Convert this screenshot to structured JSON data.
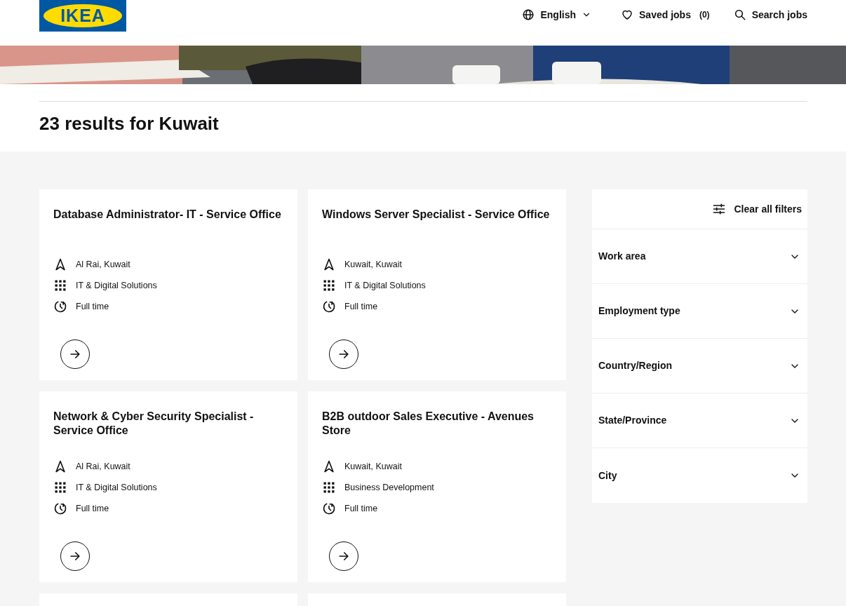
{
  "header": {
    "logo": "IKEA",
    "language": "English",
    "saved_jobs": {
      "label": "Saved jobs",
      "count": "(0)"
    },
    "search": "Search jobs"
  },
  "results_heading": "23 results for Kuwait",
  "jobs": [
    {
      "title": "Database Administrator- IT - Service Office",
      "location": "Al Rai, Kuwait",
      "work_area": "IT & Digital Solutions",
      "schedule": "Full time"
    },
    {
      "title": "Windows Server Specialist - Service Office",
      "location": "Kuwait, Kuwait",
      "work_area": "IT & Digital Solutions",
      "schedule": "Full time"
    },
    {
      "title": "Network & Cyber Security Specialist - Service Office",
      "location": "Al Rai, Kuwait",
      "work_area": "IT & Digital Solutions",
      "schedule": "Full time"
    },
    {
      "title": "B2B outdoor Sales Executive - Avenues Store",
      "location": "Kuwait, Kuwait",
      "work_area": "Business Development",
      "schedule": "Full time"
    }
  ],
  "filters": {
    "clear_label": "Clear all filters",
    "items": [
      {
        "label": "Work area",
        "expanded": false
      },
      {
        "label": "Employment type",
        "expanded": false
      },
      {
        "label": "Country/Region",
        "expanded": false
      },
      {
        "label": "State/Province",
        "expanded": false
      },
      {
        "label": "City",
        "expanded": false
      }
    ]
  }
}
